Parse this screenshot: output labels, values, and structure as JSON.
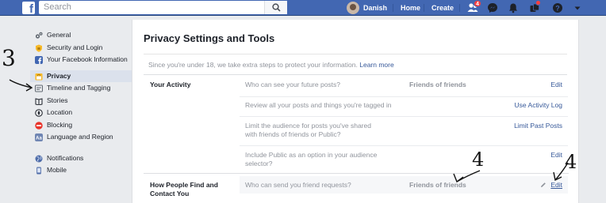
{
  "topbar": {
    "search_placeholder": "Search",
    "user_name": "Danish",
    "home_label": "Home",
    "create_label": "Create",
    "friend_requests_badge": "4",
    "colors": {
      "bar": "#4267b2",
      "badge": "#fa3e3e"
    }
  },
  "sidebar": {
    "items": [
      {
        "label": "General",
        "icon": "gears-icon"
      },
      {
        "label": "Security and Login",
        "icon": "shield-icon"
      },
      {
        "label": "Your Facebook Information",
        "icon": "facebook-icon"
      },
      {
        "label": "Privacy",
        "icon": "privacy-lock-icon"
      },
      {
        "label": "Timeline and Tagging",
        "icon": "timeline-icon"
      },
      {
        "label": "Stories",
        "icon": "book-icon"
      },
      {
        "label": "Location",
        "icon": "compass-icon"
      },
      {
        "label": "Blocking",
        "icon": "block-icon"
      },
      {
        "label": "Language and Region",
        "icon": "language-icon"
      },
      {
        "label": "Notifications",
        "icon": "globe-icon"
      },
      {
        "label": "Mobile",
        "icon": "mobile-icon"
      }
    ]
  },
  "main": {
    "title": "Privacy Settings and Tools",
    "notice": "Since you're under 18, we take extra steps to protect your information.",
    "notice_link": "Learn more",
    "sections": [
      {
        "title": "Your Activity",
        "rows": [
          {
            "question": "Who can see your future posts?",
            "value": "Friends of friends",
            "action": "Edit"
          },
          {
            "question": "Review all your posts and things you're tagged in",
            "value": "",
            "action": "Use Activity Log"
          },
          {
            "question": "Limit the audience for posts you've shared with friends of friends or Public?",
            "value": "",
            "action": "Limit Past Posts"
          },
          {
            "question": "Include Public as an option in your audience selector?",
            "value": "",
            "action": "Edit"
          }
        ]
      },
      {
        "title": "How People Find and Contact You",
        "rows": [
          {
            "question": "Who can send you friend requests?",
            "value": "Friends of friends",
            "action": "Edit"
          }
        ]
      }
    ]
  },
  "annotations": {
    "left_number": "3",
    "value_number": "4",
    "edit_number": "4"
  }
}
